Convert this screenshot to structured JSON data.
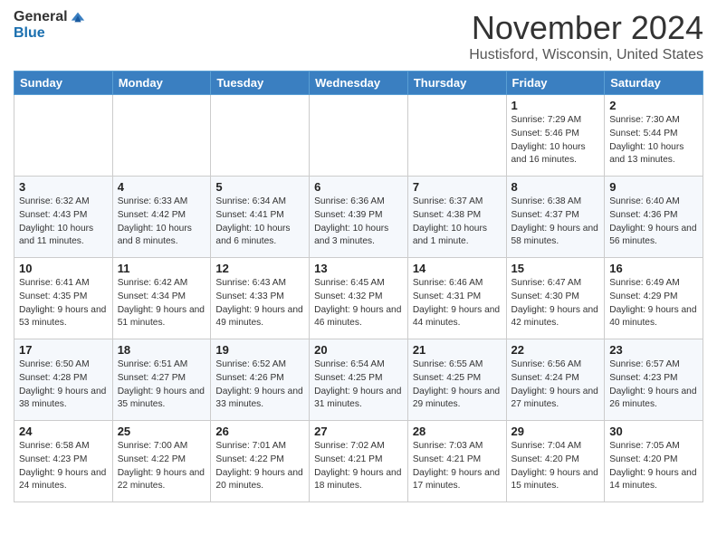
{
  "header": {
    "logo_general": "General",
    "logo_blue": "Blue",
    "month_title": "November 2024",
    "location": "Hustisford, Wisconsin, United States"
  },
  "weekdays": [
    "Sunday",
    "Monday",
    "Tuesday",
    "Wednesday",
    "Thursday",
    "Friday",
    "Saturday"
  ],
  "weeks": [
    [
      {
        "day": "",
        "info": ""
      },
      {
        "day": "",
        "info": ""
      },
      {
        "day": "",
        "info": ""
      },
      {
        "day": "",
        "info": ""
      },
      {
        "day": "",
        "info": ""
      },
      {
        "day": "1",
        "info": "Sunrise: 7:29 AM\nSunset: 5:46 PM\nDaylight: 10 hours and 16 minutes."
      },
      {
        "day": "2",
        "info": "Sunrise: 7:30 AM\nSunset: 5:44 PM\nDaylight: 10 hours and 13 minutes."
      }
    ],
    [
      {
        "day": "3",
        "info": "Sunrise: 6:32 AM\nSunset: 4:43 PM\nDaylight: 10 hours and 11 minutes."
      },
      {
        "day": "4",
        "info": "Sunrise: 6:33 AM\nSunset: 4:42 PM\nDaylight: 10 hours and 8 minutes."
      },
      {
        "day": "5",
        "info": "Sunrise: 6:34 AM\nSunset: 4:41 PM\nDaylight: 10 hours and 6 minutes."
      },
      {
        "day": "6",
        "info": "Sunrise: 6:36 AM\nSunset: 4:39 PM\nDaylight: 10 hours and 3 minutes."
      },
      {
        "day": "7",
        "info": "Sunrise: 6:37 AM\nSunset: 4:38 PM\nDaylight: 10 hours and 1 minute."
      },
      {
        "day": "8",
        "info": "Sunrise: 6:38 AM\nSunset: 4:37 PM\nDaylight: 9 hours and 58 minutes."
      },
      {
        "day": "9",
        "info": "Sunrise: 6:40 AM\nSunset: 4:36 PM\nDaylight: 9 hours and 56 minutes."
      }
    ],
    [
      {
        "day": "10",
        "info": "Sunrise: 6:41 AM\nSunset: 4:35 PM\nDaylight: 9 hours and 53 minutes."
      },
      {
        "day": "11",
        "info": "Sunrise: 6:42 AM\nSunset: 4:34 PM\nDaylight: 9 hours and 51 minutes."
      },
      {
        "day": "12",
        "info": "Sunrise: 6:43 AM\nSunset: 4:33 PM\nDaylight: 9 hours and 49 minutes."
      },
      {
        "day": "13",
        "info": "Sunrise: 6:45 AM\nSunset: 4:32 PM\nDaylight: 9 hours and 46 minutes."
      },
      {
        "day": "14",
        "info": "Sunrise: 6:46 AM\nSunset: 4:31 PM\nDaylight: 9 hours and 44 minutes."
      },
      {
        "day": "15",
        "info": "Sunrise: 6:47 AM\nSunset: 4:30 PM\nDaylight: 9 hours and 42 minutes."
      },
      {
        "day": "16",
        "info": "Sunrise: 6:49 AM\nSunset: 4:29 PM\nDaylight: 9 hours and 40 minutes."
      }
    ],
    [
      {
        "day": "17",
        "info": "Sunrise: 6:50 AM\nSunset: 4:28 PM\nDaylight: 9 hours and 38 minutes."
      },
      {
        "day": "18",
        "info": "Sunrise: 6:51 AM\nSunset: 4:27 PM\nDaylight: 9 hours and 35 minutes."
      },
      {
        "day": "19",
        "info": "Sunrise: 6:52 AM\nSunset: 4:26 PM\nDaylight: 9 hours and 33 minutes."
      },
      {
        "day": "20",
        "info": "Sunrise: 6:54 AM\nSunset: 4:25 PM\nDaylight: 9 hours and 31 minutes."
      },
      {
        "day": "21",
        "info": "Sunrise: 6:55 AM\nSunset: 4:25 PM\nDaylight: 9 hours and 29 minutes."
      },
      {
        "day": "22",
        "info": "Sunrise: 6:56 AM\nSunset: 4:24 PM\nDaylight: 9 hours and 27 minutes."
      },
      {
        "day": "23",
        "info": "Sunrise: 6:57 AM\nSunset: 4:23 PM\nDaylight: 9 hours and 26 minutes."
      }
    ],
    [
      {
        "day": "24",
        "info": "Sunrise: 6:58 AM\nSunset: 4:23 PM\nDaylight: 9 hours and 24 minutes."
      },
      {
        "day": "25",
        "info": "Sunrise: 7:00 AM\nSunset: 4:22 PM\nDaylight: 9 hours and 22 minutes."
      },
      {
        "day": "26",
        "info": "Sunrise: 7:01 AM\nSunset: 4:22 PM\nDaylight: 9 hours and 20 minutes."
      },
      {
        "day": "27",
        "info": "Sunrise: 7:02 AM\nSunset: 4:21 PM\nDaylight: 9 hours and 18 minutes."
      },
      {
        "day": "28",
        "info": "Sunrise: 7:03 AM\nSunset: 4:21 PM\nDaylight: 9 hours and 17 minutes."
      },
      {
        "day": "29",
        "info": "Sunrise: 7:04 AM\nSunset: 4:20 PM\nDaylight: 9 hours and 15 minutes."
      },
      {
        "day": "30",
        "info": "Sunrise: 7:05 AM\nSunset: 4:20 PM\nDaylight: 9 hours and 14 minutes."
      }
    ]
  ]
}
